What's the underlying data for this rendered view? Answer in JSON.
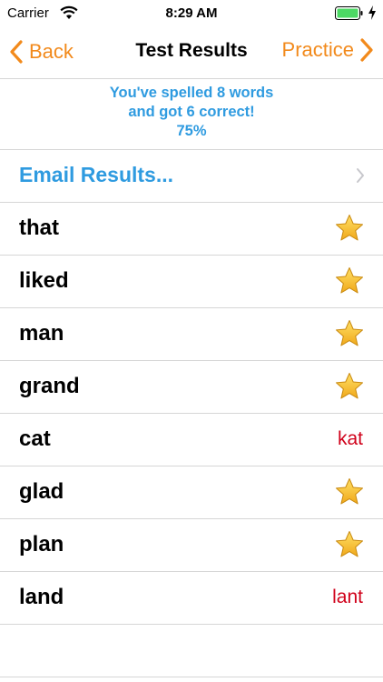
{
  "status_bar": {
    "carrier": "Carrier",
    "time": "8:29 AM"
  },
  "nav": {
    "back_label": "Back",
    "title": "Test Results",
    "practice_label": "Practice"
  },
  "summary": {
    "line1": "You've spelled 8 words",
    "line2": "and got 6 correct!",
    "line3": "75%"
  },
  "email": {
    "label": "Email Results..."
  },
  "results": [
    {
      "word": "that",
      "correct": true,
      "attempt": ""
    },
    {
      "word": "liked",
      "correct": true,
      "attempt": ""
    },
    {
      "word": "man",
      "correct": true,
      "attempt": ""
    },
    {
      "word": "grand",
      "correct": true,
      "attempt": ""
    },
    {
      "word": "cat",
      "correct": false,
      "attempt": "kat"
    },
    {
      "word": "glad",
      "correct": true,
      "attempt": ""
    },
    {
      "word": "plan",
      "correct": true,
      "attempt": ""
    },
    {
      "word": "land",
      "correct": false,
      "attempt": "lant"
    }
  ],
  "colors": {
    "accent": "#f28a1c",
    "link_blue": "#2f9be0",
    "error_red": "#d0021b",
    "star": "#f5c518"
  },
  "icons": {
    "correct": "star-icon",
    "back": "chevron-left-icon",
    "forward": "chevron-right-icon",
    "disclosure": "disclosure-chevron-icon"
  }
}
